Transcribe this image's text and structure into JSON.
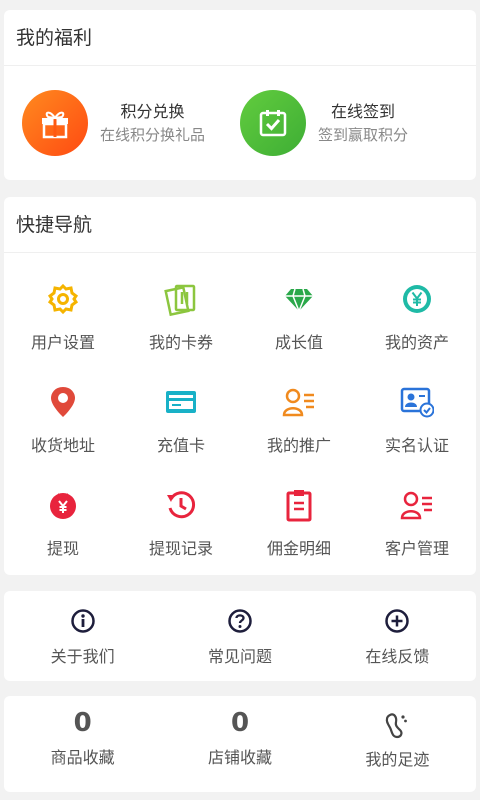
{
  "welfare": {
    "title": "我的福利",
    "items": [
      {
        "name": "积分兑换",
        "desc": "在线积分换礼品",
        "icon": "gift-icon",
        "color": "#ff6a13"
      },
      {
        "name": "在线签到",
        "desc": "签到赢取积分",
        "icon": "checkin-calendar-icon",
        "color": "#4dbd3a"
      }
    ]
  },
  "nav": {
    "title": "快捷导航",
    "items": [
      {
        "label": "用户设置",
        "icon": "gear-icon",
        "color": "#f5b400"
      },
      {
        "label": "我的卡券",
        "icon": "coupon-icon",
        "color": "#8cc63f"
      },
      {
        "label": "成长值",
        "icon": "diamond-icon",
        "color": "#2aa84a"
      },
      {
        "label": "我的资产",
        "icon": "yen-coin-icon",
        "color": "#1fbaa6"
      },
      {
        "label": "收货地址",
        "icon": "location-pin-icon",
        "color": "#e0493a"
      },
      {
        "label": "充值卡",
        "icon": "card-icon",
        "color": "#18b1c7"
      },
      {
        "label": "我的推广",
        "icon": "promotion-user-icon",
        "color": "#f08a1e"
      },
      {
        "label": "实名认证",
        "icon": "id-verify-icon",
        "color": "#2a73d9"
      },
      {
        "label": "提现",
        "icon": "money-bag-icon",
        "color": "#e8243d"
      },
      {
        "label": "提现记录",
        "icon": "history-icon",
        "color": "#e8243d"
      },
      {
        "label": "佣金明细",
        "icon": "clipboard-icon",
        "color": "#e8243d"
      },
      {
        "label": "客户管理",
        "icon": "customer-icon",
        "color": "#e8243d"
      }
    ]
  },
  "help": {
    "items": [
      {
        "label": "关于我们",
        "icon": "info-icon"
      },
      {
        "label": "常见问题",
        "icon": "question-icon"
      },
      {
        "label": "在线反馈",
        "icon": "plus-circle-icon"
      }
    ],
    "icon_color": "#1e1e3c"
  },
  "collect": {
    "items": [
      {
        "count": "0",
        "label": "商品收藏"
      },
      {
        "count": "0",
        "label": "店铺收藏"
      },
      {
        "label": "我的足迹",
        "icon": "footprint-icon"
      }
    ]
  }
}
